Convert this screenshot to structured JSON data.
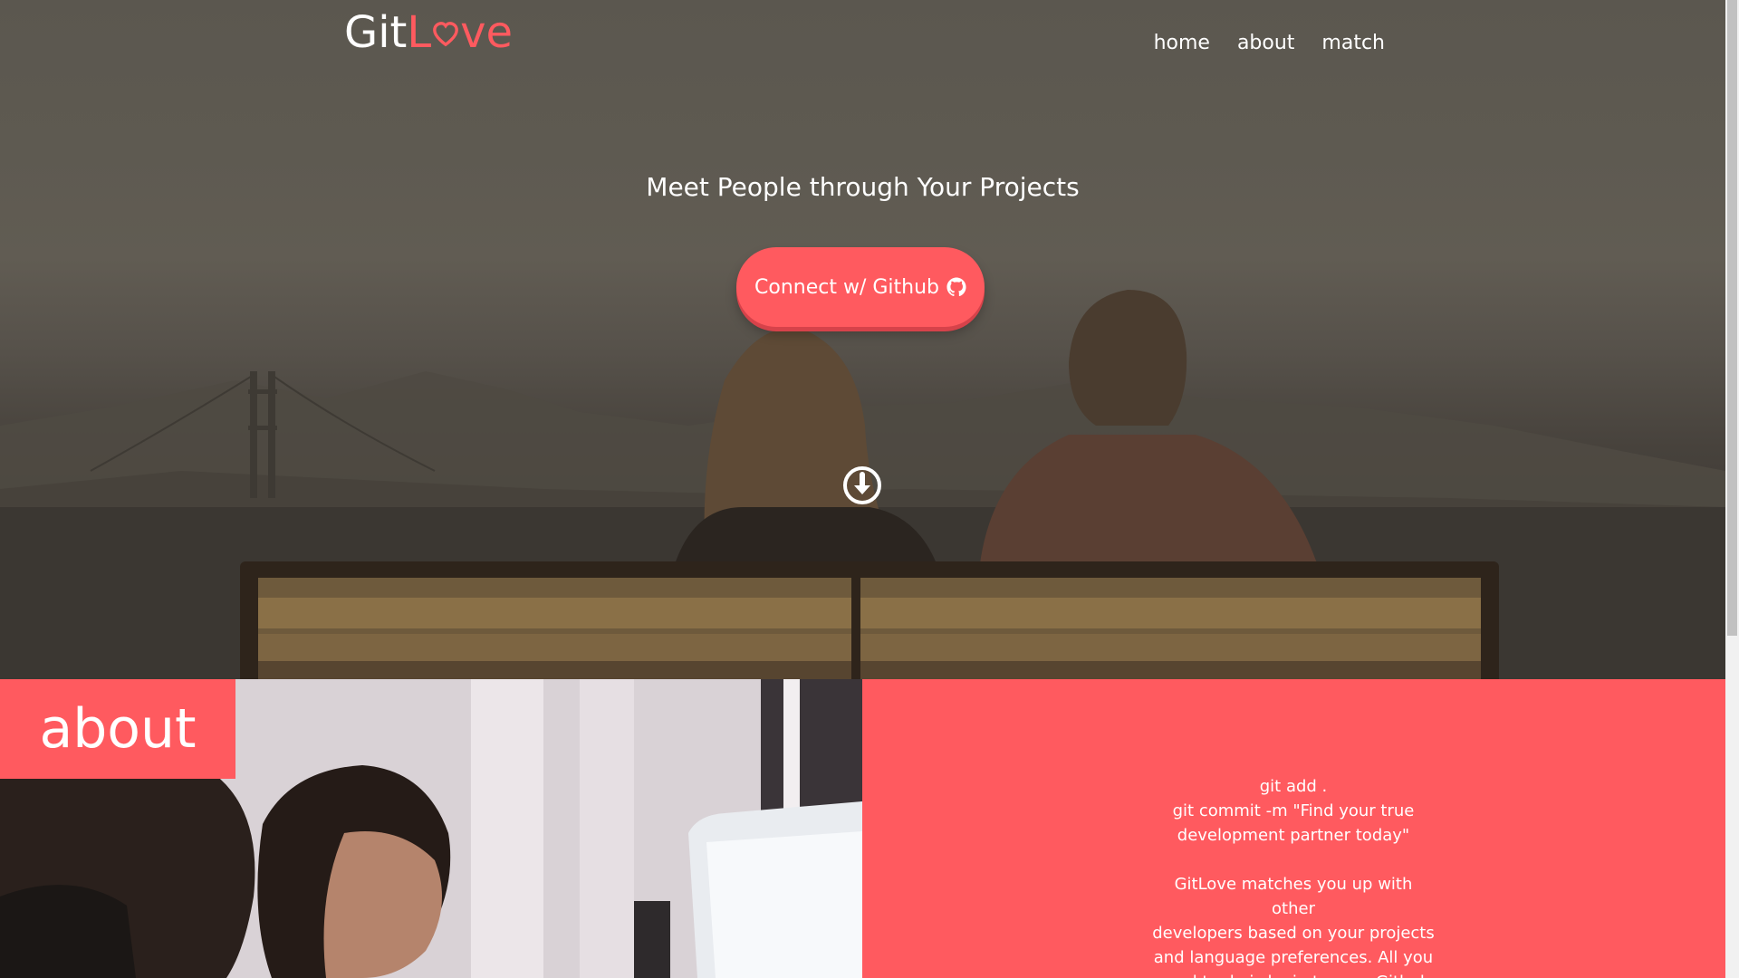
{
  "brand": {
    "name_part1": "Git",
    "name_part2a": "L",
    "name_part2b": "ve",
    "accent": "#ff5a5f",
    "heart_icon": "heart-icon"
  },
  "nav": {
    "items": [
      {
        "label": "home"
      },
      {
        "label": "about"
      },
      {
        "label": "match"
      }
    ]
  },
  "hero": {
    "tagline": "Meet People through Your Projects",
    "cta_label": "Connect w/ Github",
    "cta_icon": "github-icon",
    "scroll_icon": "arrow-circle-down-icon"
  },
  "about": {
    "badge": "about",
    "lines_group1": [
      "git add .",
      "git commit -m \"Find your true",
      "development partner today\""
    ],
    "lines_group2": [
      "GitLove matches you up with other",
      "developers based on your projects",
      "and language preferences. All you",
      "need to do is login to your Github"
    ]
  },
  "colors": {
    "accent": "#ff5a5f",
    "text": "#ffffff",
    "hero_overlay": "#5b574f"
  }
}
